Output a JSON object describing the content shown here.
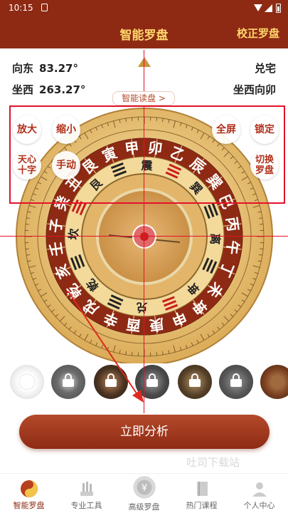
{
  "status": {
    "time": "10:15"
  },
  "header": {
    "title": "智能罗盘",
    "calibrate": "校正罗盘"
  },
  "info": {
    "facing_label": "向东",
    "facing_value": "83.27°",
    "house": "兑宅",
    "sitting_label": "坐西",
    "sitting_value": "263.27°",
    "orientation": "坐西向卯"
  },
  "read_disk": "智能读盘 >",
  "controls": {
    "zoom_in": "放大",
    "zoom_out": "缩小",
    "fullscreen": "全屏",
    "lock": "锁定",
    "crosshair_line1": "天心",
    "crosshair_line2": "十字",
    "manual": "手动",
    "switch_line1": "切换",
    "switch_line2": "罗盘"
  },
  "compass": {
    "mountains": [
      "甲",
      "卯",
      "乙",
      "辰",
      "巽",
      "巳",
      "丙",
      "午",
      "丁",
      "未",
      "坤",
      "申",
      "庚",
      "酉",
      "辛",
      "戌",
      "乾",
      "亥",
      "壬",
      "子",
      "癸",
      "丑",
      "艮",
      "寅"
    ],
    "trigrams": [
      "震",
      "巽",
      "离",
      "坤",
      "兑",
      "乾",
      "坎",
      "艮"
    ],
    "accent": "#8e2a14",
    "gold": "#e9c67a"
  },
  "thumbnails": [
    {
      "locked": false
    },
    {
      "locked": true
    },
    {
      "locked": true
    },
    {
      "locked": true
    },
    {
      "locked": true
    },
    {
      "locked": true
    },
    {
      "locked": false
    }
  ],
  "analyze_button": "立即分析",
  "watermark": "吐司下载站",
  "tabs": [
    {
      "label": "智能罗盘",
      "icon": "yin-yang-icon",
      "active": true
    },
    {
      "label": "专业工具",
      "icon": "tools-icon",
      "active": false
    },
    {
      "label": "高级罗盘",
      "icon": "coin-icon",
      "active": false
    },
    {
      "label": "热门课程",
      "icon": "book-icon",
      "active": false
    },
    {
      "label": "个人中心",
      "icon": "user-icon",
      "active": false
    }
  ]
}
